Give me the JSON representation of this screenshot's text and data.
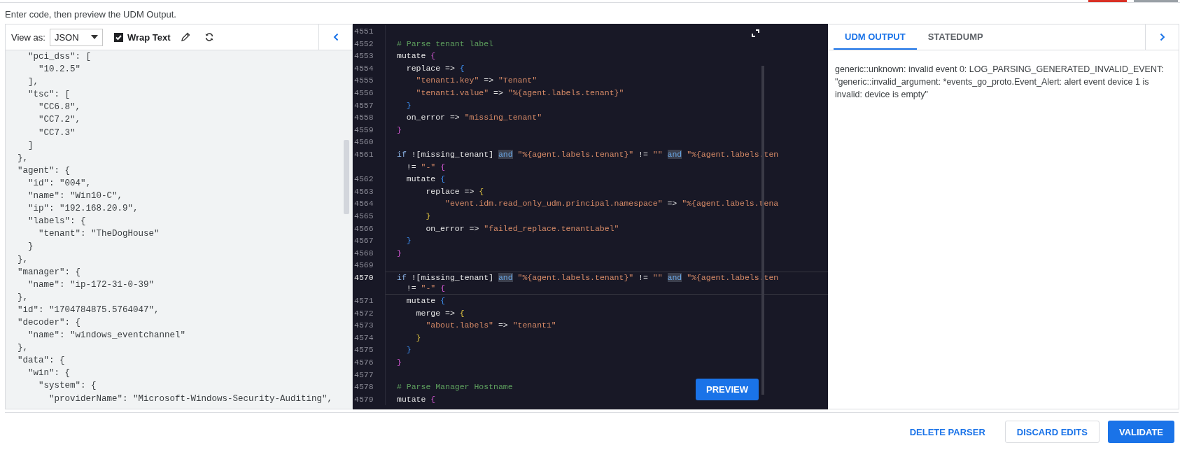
{
  "instructions": "Enter code, then preview the UDM Output.",
  "input_panel": {
    "view_as_label": "View as:",
    "view_as_value": "JSON",
    "wrap_text": {
      "label": "Wrap Text",
      "checked": true
    },
    "lines": [
      "    \"pci_dss\": [",
      "      \"10.2.5\"",
      "    ],",
      "    \"tsc\": [",
      "      \"CC6.8\",",
      "      \"CC7.2\",",
      "      \"CC7.3\"",
      "    ]",
      "  },",
      "  \"agent\": {",
      "    \"id\": \"004\",",
      "    \"name\": \"Win10-C\",",
      "    \"ip\": \"192.168.20.9\",",
      "    \"labels\": {",
      "      \"tenant\": \"TheDogHouse\"",
      "    }",
      "  },",
      "  \"manager\": {",
      "    \"name\": \"ip-172-31-0-39\"",
      "  },",
      "  \"id\": \"1704784875.5764047\",",
      "  \"decoder\": {",
      "    \"name\": \"windows_eventchannel\"",
      "  },",
      "  \"data\": {",
      "    \"win\": {",
      "      \"system\": {",
      "        \"providerName\": \"Microsoft-Windows-Security-Auditing\","
    ]
  },
  "editor": {
    "preview_button": "PREVIEW",
    "lines": [
      {
        "number": "4551",
        "current": false
      },
      {
        "number": "4552",
        "current": false,
        "tokens": [
          {
            "kind": "comment",
            "text": "# Parse tenant label"
          }
        ]
      },
      {
        "number": "4553",
        "current": false,
        "tokens": [
          {
            "kind": "plain",
            "text": "mutate "
          },
          {
            "kind": "brace_pink",
            "text": "{"
          }
        ]
      },
      {
        "number": "4554",
        "current": false,
        "tokens": [
          {
            "kind": "plain",
            "text": "  replace => "
          },
          {
            "kind": "brace_blue",
            "text": "{"
          }
        ]
      },
      {
        "number": "4555",
        "current": false,
        "tokens": [
          {
            "kind": "string",
            "text": "    \"tenant1.key\""
          },
          {
            "kind": "plain",
            "text": " => "
          },
          {
            "kind": "string",
            "text": "\"Tenant\""
          }
        ]
      },
      {
        "number": "4556",
        "current": false,
        "tokens": [
          {
            "kind": "string",
            "text": "    \"tenant1.value\""
          },
          {
            "kind": "plain",
            "text": " => "
          },
          {
            "kind": "string",
            "text": "\"%{agent.labels.tenant}\""
          }
        ]
      },
      {
        "number": "4557",
        "current": false,
        "tokens": [
          {
            "kind": "brace_blue",
            "text": "  }"
          }
        ]
      },
      {
        "number": "4558",
        "current": false,
        "tokens": [
          {
            "kind": "plain",
            "text": "  on_error => "
          },
          {
            "kind": "string",
            "text": "\"missing_tenant\""
          }
        ]
      },
      {
        "number": "4559",
        "current": false,
        "tokens": [
          {
            "kind": "brace_pink",
            "text": "}"
          }
        ]
      },
      {
        "number": "4560",
        "current": false
      },
      {
        "number": "4561",
        "current": false,
        "tokens": [
          {
            "kind": "control",
            "text": "if "
          },
          {
            "kind": "plain",
            "text": "![missing_tenant] "
          },
          {
            "kind": "match",
            "text": "and"
          },
          {
            "kind": "string",
            "text": " \"%{agent.labels.tenant}\""
          },
          {
            "kind": "plain",
            "text": " != "
          },
          {
            "kind": "string",
            "text": "\"\" "
          },
          {
            "kind": "match",
            "text": "and"
          },
          {
            "kind": "string",
            "text": " \"%{agent.labels.ten"
          }
        ],
        "wrap": [
          {
            "kind": "plain",
            "text": "  != "
          },
          {
            "kind": "string",
            "text": "\"-\" "
          },
          {
            "kind": "brace_pink",
            "text": "{"
          }
        ]
      },
      {
        "number": "4562",
        "current": false,
        "tokens": [
          {
            "kind": "plain",
            "text": "  mutate "
          },
          {
            "kind": "brace_blue",
            "text": "{"
          }
        ]
      },
      {
        "number": "4563",
        "current": false,
        "tokens": [
          {
            "kind": "plain",
            "text": "      replace => "
          },
          {
            "kind": "brace_yellow",
            "text": "{"
          }
        ]
      },
      {
        "number": "4564",
        "current": false,
        "tokens": [
          {
            "kind": "string",
            "text": "          \"event.idm.read_only_udm.principal.namespace\""
          },
          {
            "kind": "plain",
            "text": " => "
          },
          {
            "kind": "string",
            "text": "\"%{agent.labels.tena"
          }
        ]
      },
      {
        "number": "4565",
        "current": false,
        "tokens": [
          {
            "kind": "brace_yellow",
            "text": "      }"
          }
        ]
      },
      {
        "number": "4566",
        "current": false,
        "tokens": [
          {
            "kind": "plain",
            "text": "      on_error => "
          },
          {
            "kind": "string",
            "text": "\"failed_replace.tenantLabel\""
          }
        ]
      },
      {
        "number": "4567",
        "current": false,
        "tokens": [
          {
            "kind": "brace_blue",
            "text": "  }"
          }
        ]
      },
      {
        "number": "4568",
        "current": false,
        "tokens": [
          {
            "kind": "brace_pink",
            "text": "}"
          }
        ]
      },
      {
        "number": "4569",
        "current": false
      },
      {
        "number": "4570",
        "current": true,
        "tokens": [
          {
            "kind": "control",
            "text": "if "
          },
          {
            "kind": "plain",
            "text": "![missing_tenant] "
          },
          {
            "kind": "match",
            "text": "and"
          },
          {
            "kind": "string",
            "text": " \"%{agent.labels.tenant}\""
          },
          {
            "kind": "plain",
            "text": " != "
          },
          {
            "kind": "string",
            "text": "\"\" "
          },
          {
            "kind": "match",
            "text": "and"
          },
          {
            "kind": "string",
            "text": " \"%{agent.labels.ten"
          }
        ],
        "wrap": [
          {
            "kind": "plain",
            "text": "  != "
          },
          {
            "kind": "string",
            "text": "\"-\" "
          },
          {
            "kind": "brace_pink",
            "text": "{"
          }
        ]
      },
      {
        "number": "4571",
        "current": false,
        "tokens": [
          {
            "kind": "plain",
            "text": "  mutate "
          },
          {
            "kind": "brace_blue",
            "text": "{"
          }
        ]
      },
      {
        "number": "4572",
        "current": false,
        "tokens": [
          {
            "kind": "plain",
            "text": "    merge => "
          },
          {
            "kind": "brace_yellow",
            "text": "{"
          }
        ]
      },
      {
        "number": "4573",
        "current": false,
        "tokens": [
          {
            "kind": "string",
            "text": "      \"about.labels\""
          },
          {
            "kind": "plain",
            "text": " => "
          },
          {
            "kind": "string",
            "text": "\"tenant1\""
          }
        ]
      },
      {
        "number": "4574",
        "current": false,
        "tokens": [
          {
            "kind": "brace_yellow",
            "text": "    }"
          }
        ]
      },
      {
        "number": "4575",
        "current": false,
        "tokens": [
          {
            "kind": "brace_blue",
            "text": "  }"
          }
        ]
      },
      {
        "number": "4576",
        "current": false,
        "tokens": [
          {
            "kind": "brace_pink",
            "text": "}"
          }
        ]
      },
      {
        "number": "4577",
        "current": false
      },
      {
        "number": "4578",
        "current": false,
        "tokens": [
          {
            "kind": "comment",
            "text": "# Parse Manager Hostname"
          }
        ]
      },
      {
        "number": "4579",
        "current": false,
        "tokens": [
          {
            "kind": "plain",
            "text": "mutate "
          },
          {
            "kind": "brace_pink",
            "text": "{"
          }
        ]
      }
    ]
  },
  "output_panel": {
    "tabs": [
      {
        "label": "UDM OUTPUT",
        "selected": true
      },
      {
        "label": "STATEDUMP",
        "selected": false
      }
    ],
    "message": "generic::unknown: invalid event 0: LOG_PARSING_GENERATED_INVALID_EVENT: \"generic::invalid_argument: *events_go_proto.Event_Alert: alert event device 1 is invalid: device is empty\""
  },
  "footer_buttons": [
    {
      "label": "DELETE PARSER",
      "kind": "text"
    },
    {
      "label": "DISCARD EDITS",
      "kind": "outlined"
    },
    {
      "label": "VALIDATE",
      "kind": "filled"
    }
  ]
}
